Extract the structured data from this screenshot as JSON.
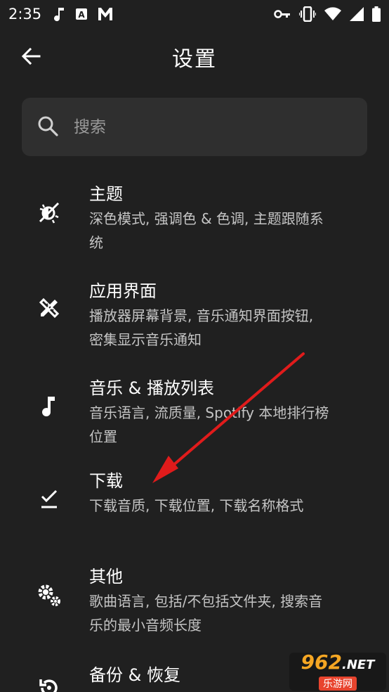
{
  "status_bar": {
    "time": "2:35",
    "left_icons": [
      "music-note-icon",
      "a-box-icon",
      "m-logo-icon"
    ],
    "right_icons": [
      "key-icon",
      "vibrate-icon",
      "wifi-icon",
      "signal-icon",
      "battery-icon"
    ]
  },
  "header": {
    "title": "设置",
    "back_icon": "arrow-left-icon"
  },
  "search": {
    "placeholder": "搜索",
    "value": ""
  },
  "settings": [
    {
      "icon": "theme-icon",
      "title": "主题",
      "desc_lines": [
        "深色模式, 强调色 & 色调, 主题跟随系",
        "统"
      ]
    },
    {
      "icon": "tools-icon",
      "title": "应用界面",
      "desc_lines": [
        "播放器屏幕背景, 音乐通知界面按钮,",
        "密集显示音乐通知"
      ]
    },
    {
      "icon": "music-note-icon",
      "title": "音乐 & 播放列表",
      "desc_lines": [
        "音乐语言, 流质量, Spotify 本地排行榜",
        "位置"
      ]
    },
    {
      "icon": "download-check-icon",
      "title": "下载",
      "desc_lines": [
        "下载音质, 下载位置, 下载名称格式"
      ]
    },
    {
      "icon": "gears-icon",
      "title": "其他",
      "desc_lines": [
        "歌曲语言, 包括/不包括文件夹, 搜索音",
        "乐的最小音频长度"
      ]
    },
    {
      "icon": "restore-icon",
      "title": "备份 & 恢复",
      "desc_lines": []
    }
  ],
  "watermark": {
    "logo_text": "962",
    "logo_suffix": ".NET",
    "sub_text": "乐游网"
  },
  "colors": {
    "background": "#202020",
    "search_bg": "#2f2f2f",
    "secondary_text": "#c4c4c4",
    "annotation_arrow": "#e01b1b"
  }
}
